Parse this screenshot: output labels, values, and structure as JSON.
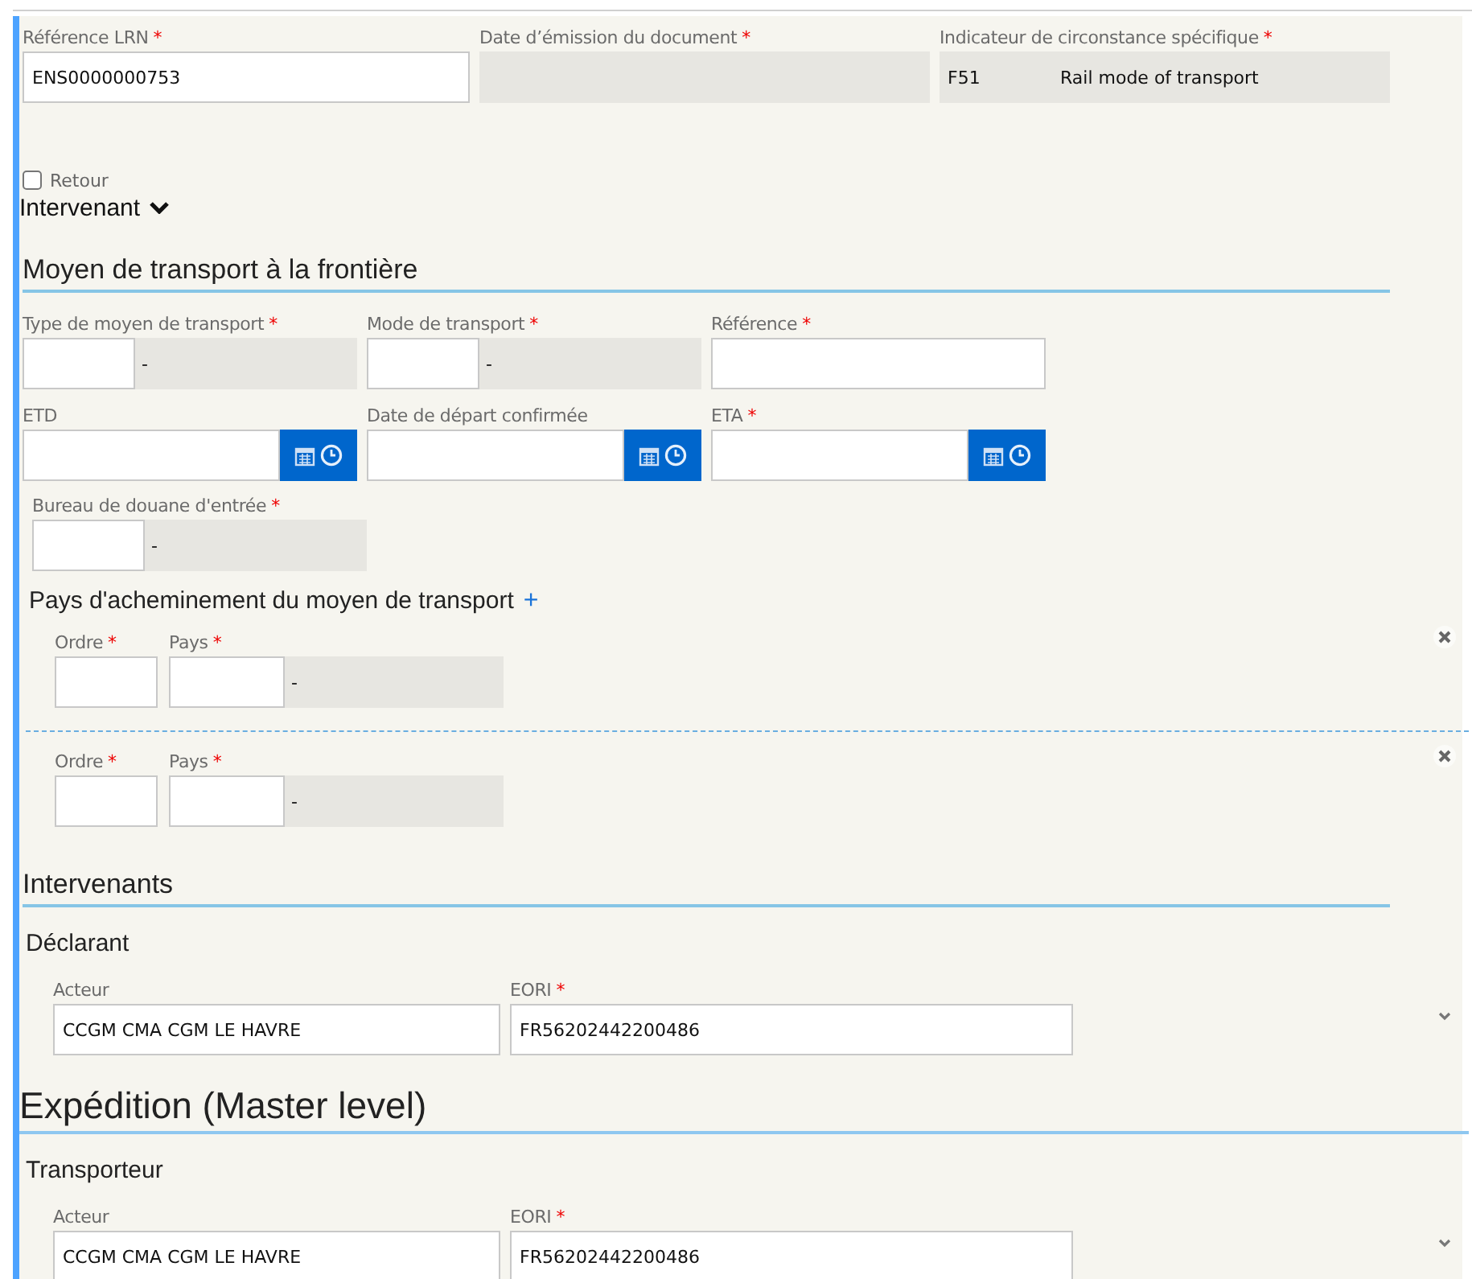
{
  "header_fields": [
    {
      "kind": "text",
      "label": "Référence LRN",
      "mark": "*",
      "value": "ENS0000000753"
    },
    {
      "kind": "readonly",
      "label": "Date d’émission du document",
      "mark": "*"
    },
    {
      "kind": "readonly_pair",
      "label": "Indicateur de circonstance spécifique",
      "mark": "*",
      "code": "F51",
      "description": "Rail mode of transport"
    }
  ],
  "retour": {
    "label": "Retour",
    "checked": false
  },
  "intervenant_toggle": {
    "label": "Intervenant",
    "expanded": false
  },
  "transport": {
    "title": "Moyen de transport à la frontière",
    "rows": [
      [
        {
          "kind": "lookup",
          "label": "Type de moyen de transport",
          "mark": "*",
          "description": "-"
        },
        {
          "kind": "lookup",
          "label": "Mode de transport",
          "mark": "*",
          "description": "-"
        },
        {
          "kind": "text",
          "label": "Référence",
          "mark": "*"
        }
      ],
      [
        {
          "kind": "datetime",
          "label": "ETD"
        },
        {
          "kind": "datetime",
          "label": "Date de départ confirmée"
        },
        {
          "kind": "datetime",
          "label": "ETA",
          "mark": "*"
        }
      ],
      [
        {
          "kind": "lookup",
          "label": "Bureau de douane d'entrée",
          "mark": "*",
          "description": "-"
        }
      ]
    ],
    "countries": {
      "title": "Pays d'acheminement du moyen de transport",
      "add_symbol": "+",
      "items": [
        {
          "order_label": "Ordre",
          "order_mark": "*",
          "country_label": "Pays",
          "country_mark": "*",
          "description": "-"
        },
        {
          "order_label": "Ordre",
          "order_mark": "*",
          "country_label": "Pays",
          "country_mark": "*",
          "description": "-"
        }
      ]
    }
  },
  "sections": [
    {
      "title": "Intervenants",
      "kind": "minor",
      "parties": [
        {
          "title": "Déclarant",
          "actor_label": "Acteur",
          "actor": "CCGM CMA CGM LE HAVRE",
          "eori_label": "EORI",
          "eori_mark": "*",
          "eori": "FR56202442200486"
        }
      ]
    },
    {
      "title": "Expédition (Master level)",
      "kind": "major",
      "parties": [
        {
          "title": "Transporteur",
          "actor_label": "Acteur",
          "actor": "CCGM CMA CGM LE HAVRE",
          "eori_label": "EORI",
          "eori_mark": "*",
          "eori": "FR56202442200486"
        }
      ]
    }
  ]
}
